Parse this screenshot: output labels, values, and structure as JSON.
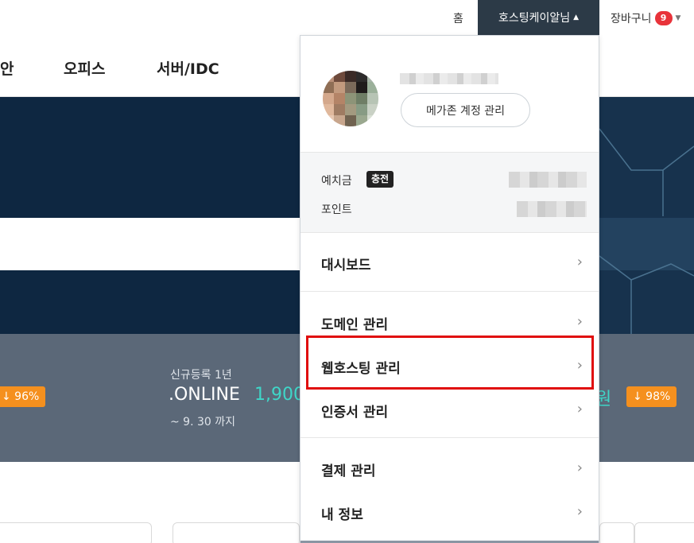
{
  "topbar": {
    "home": "홈",
    "user_menu": "호스팅케이알님",
    "user_caret": "▲",
    "cart": "장바구니",
    "cart_count": "9",
    "cart_caret": "▼"
  },
  "nav": {
    "items": [
      "안",
      "오피스",
      "서버/IDC"
    ]
  },
  "promo": {
    "subtitle": "신규등록 1년",
    "tld": ".ONLINE",
    "price": "1,900",
    "until": "~ 9. 30 까지",
    "left_discount": "↓ 96%",
    "right_price": "원",
    "right_discount": "↓ 98%"
  },
  "dropdown": {
    "account_button": "메가존 계정 관리",
    "deposit_label": "예치금",
    "charge_label": "충전",
    "points_label": "포인트",
    "menu": [
      {
        "label": "대시보드"
      },
      {
        "label": "도메인 관리"
      },
      {
        "label": "웹호스팅 관리"
      },
      {
        "label": "인증서 관리"
      },
      {
        "label": "결제 관리"
      },
      {
        "label": "내 정보"
      }
    ],
    "chevron": "›"
  },
  "colors": {
    "dark_navy": "#0e2741",
    "user_menu_bg": "#2c3a47",
    "promo_bg": "#5b6878",
    "accent_teal": "#3fd6c8",
    "discount_orange": "#f5901e",
    "badge_red": "#e8333a",
    "highlight_red": "#e00d0d"
  }
}
